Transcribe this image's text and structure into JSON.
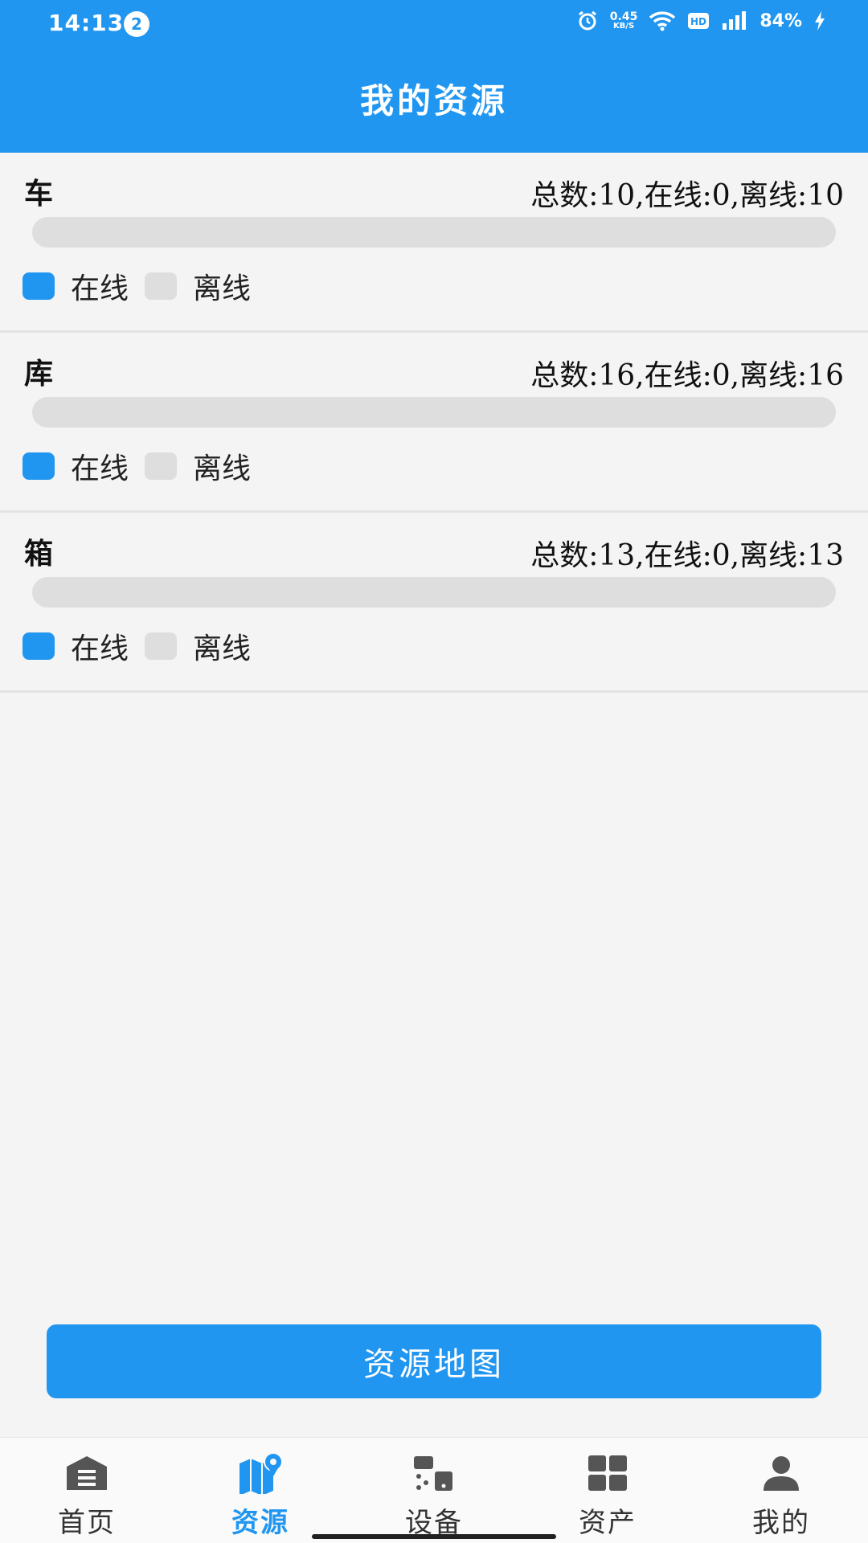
{
  "status_bar": {
    "time": "14:13",
    "notification_count": "2",
    "net_speed_value": "0.45",
    "net_speed_unit": "KB/S",
    "battery": "84%"
  },
  "header": {
    "title": "我的资源"
  },
  "resources": [
    {
      "name": "车",
      "summary": "总数:10,在线:0,离线:10",
      "online_fraction": 0
    },
    {
      "name": "库",
      "summary": "总数:16,在线:0,离线:16",
      "online_fraction": 0
    },
    {
      "name": "箱",
      "summary": "总数:13,在线:0,离线:13",
      "online_fraction": 0
    }
  ],
  "legend": {
    "online": "在线",
    "offline": "离线"
  },
  "map_button": {
    "label": "资源地图"
  },
  "bottom_nav": {
    "items": [
      {
        "label": "首页",
        "icon": "home-icon"
      },
      {
        "label": "资源",
        "icon": "map-pin-icon"
      },
      {
        "label": "设备",
        "icon": "devices-icon"
      },
      {
        "label": "资产",
        "icon": "grid-icon"
      },
      {
        "label": "我的",
        "icon": "person-icon"
      }
    ],
    "active_index": 1
  },
  "colors": {
    "primary": "#2196f0",
    "track": "#dedede",
    "background": "#f4f4f4"
  }
}
